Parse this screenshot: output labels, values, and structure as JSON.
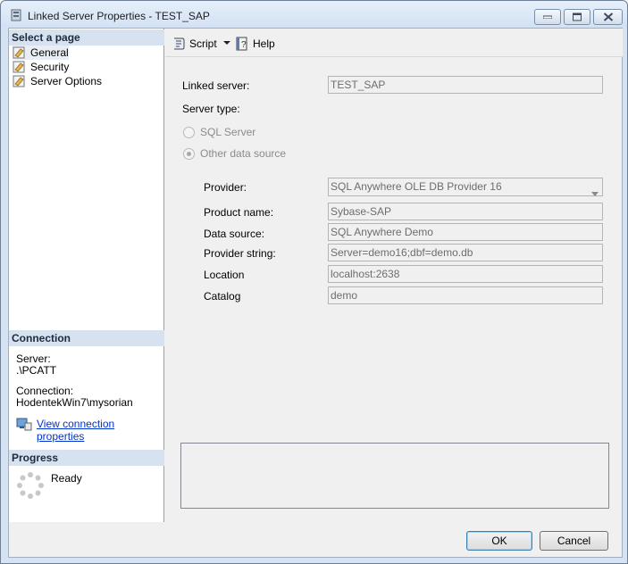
{
  "window": {
    "title": "Linked Server Properties - TEST_SAP"
  },
  "left_pane": {
    "select_page_header": "Select a page",
    "pages": [
      {
        "label": "General"
      },
      {
        "label": "Security"
      },
      {
        "label": "Server Options"
      }
    ],
    "connection_header": "Connection",
    "server_label": "Server:",
    "server_value": ".\\PCATT",
    "connection_label": "Connection:",
    "connection_value": "HodentekWin7\\mysorian",
    "view_connection_link": "View connection properties",
    "progress_header": "Progress",
    "progress_status": "Ready"
  },
  "toolbar": {
    "script_label": "Script",
    "help_label": "Help"
  },
  "general": {
    "linked_server_label": "Linked server:",
    "linked_server_value": "TEST_SAP",
    "server_type_label": "Server type:",
    "sql_server_option": "SQL Server",
    "other_source_option": "Other data source",
    "provider_label": "Provider:",
    "provider_value": "SQL Anywhere OLE DB Provider 16",
    "product_name_label": "Product name:",
    "product_name_value": "Sybase-SAP",
    "data_source_label": "Data source:",
    "data_source_value": "SQL Anywhere Demo",
    "provider_string_label": "Provider string:",
    "provider_string_value": "Server=demo16;dbf=demo.db",
    "location_label": "Location",
    "location_value": "localhost:2638",
    "catalog_label": "Catalog",
    "catalog_value": "demo"
  },
  "buttons": {
    "ok": "OK",
    "cancel": "Cancel"
  }
}
